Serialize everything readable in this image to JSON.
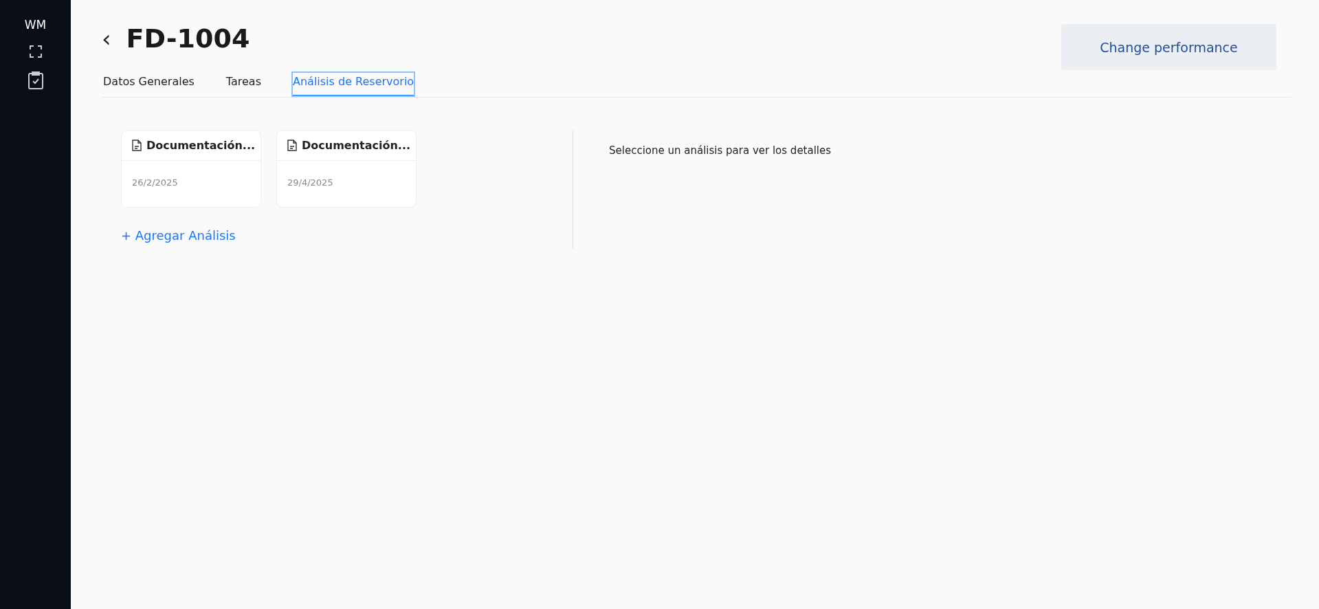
{
  "sidebar": {
    "logo": "WM",
    "items": [
      {
        "kind": "expand"
      },
      {
        "kind": "clipboard"
      }
    ]
  },
  "header": {
    "back": "‹",
    "title": "FD-1004",
    "button": "Change performance"
  },
  "tabs": [
    {
      "label": "Datos Generales",
      "selected": false
    },
    {
      "label": "Tareas",
      "selected": false
    },
    {
      "label": "Análisis de Reservorio",
      "selected": true
    }
  ],
  "analyses": [
    {
      "title": "Documentación...",
      "date": "26/2/2025"
    },
    {
      "title": "Documentación...",
      "date": "29/4/2025"
    }
  ],
  "add_link": "+ Agregar Análisis",
  "detail_message": "Seleccione un análisis para ver los detalles"
}
